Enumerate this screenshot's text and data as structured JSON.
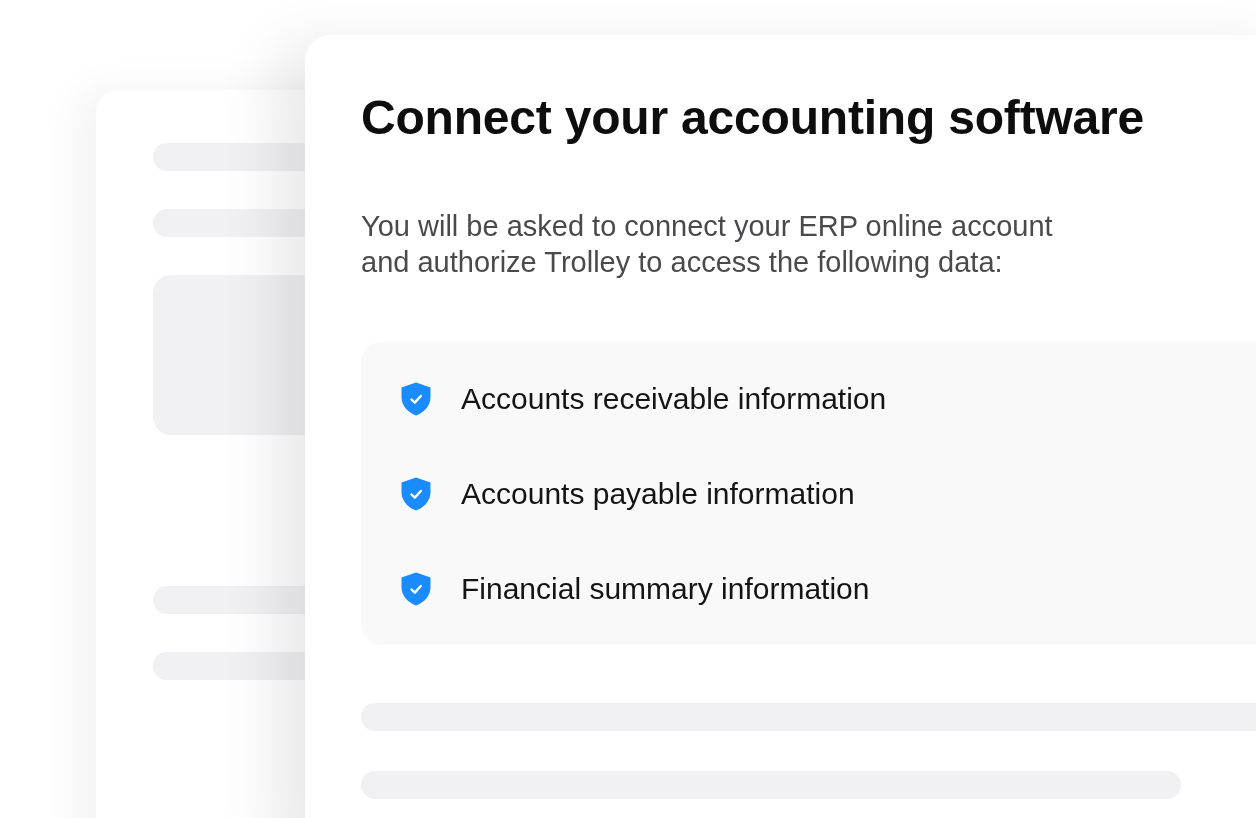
{
  "card": {
    "title": "Connect your accounting software",
    "description": "You will be asked to connect your ERP online account and authorize Trolley to access the following data:",
    "permissions": [
      {
        "label": "Accounts receivable information"
      },
      {
        "label": "Accounts payable information"
      },
      {
        "label": "Financial summary information"
      }
    ]
  }
}
